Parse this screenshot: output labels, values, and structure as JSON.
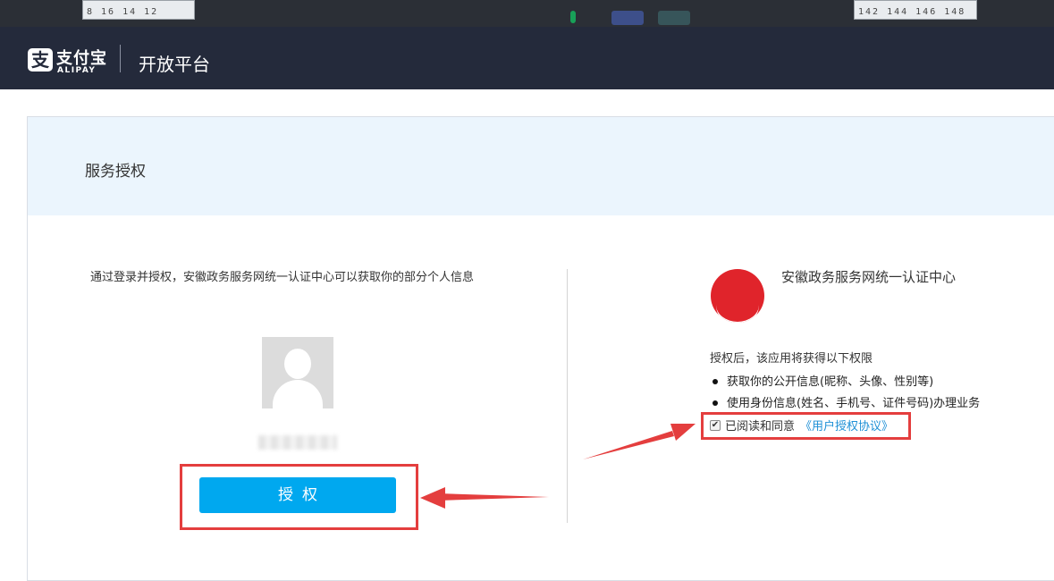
{
  "top_strip": {
    "ruler_left": "8 16 14 12",
    "ruler_right": "142 144 146 148"
  },
  "header": {
    "logo_mark": "支",
    "logo_text": "支付宝",
    "logo_sub": "ALIPAY",
    "title": "开放平台"
  },
  "card": {
    "title": "服务授权"
  },
  "left": {
    "description": "通过登录并授权，安徽政务服务网统一认证中心可以获取你的部分个人信息",
    "user_name": "",
    "authorize_button": "授权"
  },
  "right": {
    "app_name": "安徽政务服务网统一认证中心",
    "permission_intro": "授权后，该应用将获得以下权限",
    "permissions": [
      "获取你的公开信息(昵称、头像、性别等)",
      "使用身份信息(姓名、手机号、证件号码)办理业务"
    ],
    "agree_text": "已阅读和同意",
    "agree_link": "《用户授权协议》",
    "agree_checked": true
  },
  "colors": {
    "header_bg": "#242a3b",
    "card_head_bg": "#ebf5fd",
    "button_blue": "#00a8ef",
    "link_blue": "#1e90d6",
    "annotation_red": "#e43e3e",
    "app_logo_red": "#e0242b"
  }
}
